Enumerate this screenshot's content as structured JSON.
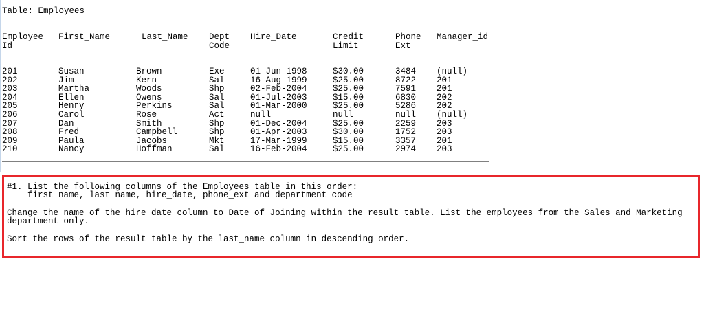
{
  "title": "Table: Employees",
  "columns": [
    {
      "line1": "Employee",
      "line2": "Id"
    },
    {
      "line1": "First_Name",
      "line2": ""
    },
    {
      "line1": "Last_Name",
      "line2": ""
    },
    {
      "line1": "Dept",
      "line2": "Code"
    },
    {
      "line1": "Hire_Date",
      "line2": ""
    },
    {
      "line1": "Credit",
      "line2": "Limit"
    },
    {
      "line1": "Phone",
      "line2": "Ext"
    },
    {
      "line1": "Manager_id",
      "line2": ""
    }
  ],
  "rows": [
    [
      "201",
      "Susan",
      "Brown",
      "Exe",
      "01-Jun-1998",
      "$30.00",
      "3484",
      "(null)"
    ],
    [
      "202",
      "Jim",
      "Kern",
      "Sal",
      "16-Aug-1999",
      "$25.00",
      "8722",
      "201"
    ],
    [
      "203",
      "Martha",
      "Woods",
      "Shp",
      "02-Feb-2004",
      "$25.00",
      "7591",
      "201"
    ],
    [
      "204",
      "Ellen",
      "Owens",
      "Sal",
      "01-Jul-2003",
      "$15.00",
      "6830",
      "202"
    ],
    [
      "205",
      "Henry",
      "Perkins",
      "Sal",
      "01-Mar-2000",
      "$25.00",
      "5286",
      "202"
    ],
    [
      "206",
      "Carol",
      "Rose",
      "Act",
      "null",
      "null",
      "null",
      "(null)"
    ],
    [
      "207",
      "Dan",
      "Smith",
      "Shp",
      "01-Dec-2004",
      "$25.00",
      "2259",
      "203"
    ],
    [
      "208",
      "Fred",
      "Campbell",
      "Shp",
      "01-Apr-2003",
      "$30.00",
      "1752",
      "203"
    ],
    [
      "209",
      "Paula",
      "Jacobs",
      "Mkt",
      "17-Mar-1999",
      "$15.00",
      "3357",
      "201"
    ],
    [
      "210",
      "Nancy",
      "Hoffman",
      "Sal",
      "16-Feb-2004",
      "$25.00",
      "2974",
      "203"
    ]
  ],
  "task": {
    "line1": "#1. List the following columns of the Employees table in this order:",
    "line2": "    first name, last name, hire_date, phone_ext and department code",
    "line3": "Change the name of the hire_date column to Date_of_Joining within the result table. List the employees from the Sales and Marketing",
    "line4": "department only.",
    "line5": "Sort the rows of the result table by the last_name column in descending order.",
    "border_color": "#e8262b"
  }
}
